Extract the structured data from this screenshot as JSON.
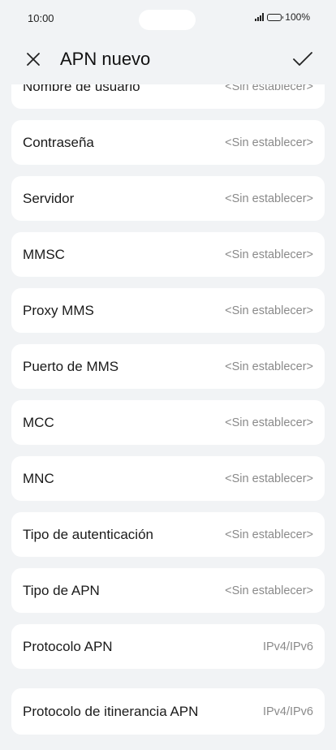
{
  "status_bar": {
    "time": "10:00",
    "battery": "100%"
  },
  "header": {
    "title": "APN nuevo",
    "close_icon": "close-icon",
    "confirm_icon": "check-icon"
  },
  "items": [
    {
      "label": "Nombre de usuario",
      "value": "<Sin establecer>"
    },
    {
      "label": "Contraseña",
      "value": "<Sin establecer>"
    },
    {
      "label": "Servidor",
      "value": "<Sin establecer>"
    },
    {
      "label": "MMSC",
      "value": "<Sin establecer>"
    },
    {
      "label": "Proxy MMS",
      "value": "<Sin establecer>"
    },
    {
      "label": "Puerto de MMS",
      "value": "<Sin establecer>"
    },
    {
      "label": "MCC",
      "value": "<Sin establecer>"
    },
    {
      "label": "MNC",
      "value": "<Sin establecer>"
    },
    {
      "label": "Tipo de autenticación",
      "value": "<Sin establecer>"
    },
    {
      "label": "Tipo de APN",
      "value": "<Sin establecer>"
    },
    {
      "label": "Protocolo APN",
      "value": "IPv4/IPv6"
    },
    {
      "label": "Protocolo de itinerancia APN",
      "value": "IPv4/IPv6"
    }
  ]
}
